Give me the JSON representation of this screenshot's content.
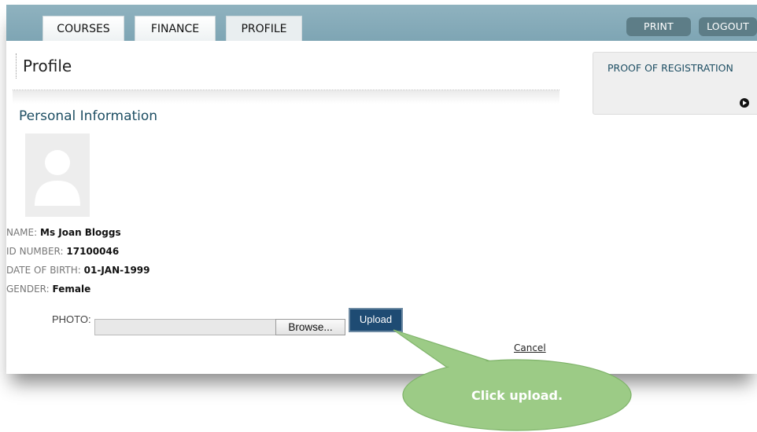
{
  "nav": {
    "tabs": [
      {
        "label": "COURSES"
      },
      {
        "label": "FINANCE"
      },
      {
        "label": "PROFILE"
      }
    ],
    "print_label": "PRINT",
    "logout_label": "LOGOUT"
  },
  "page": {
    "title": "Profile",
    "section_title": "Personal Information"
  },
  "profile": {
    "fields": [
      {
        "label": "NAME:",
        "value": "Ms Joan Bloggs"
      },
      {
        "label": "ID NUMBER:",
        "value": "17100046"
      },
      {
        "label": "DATE OF BIRTH:",
        "value": "01-JAN-1999"
      },
      {
        "label": "GENDER:",
        "value": "Female"
      }
    ]
  },
  "upload": {
    "photo_label": "PHOTO:",
    "file_value": "",
    "browse_label": "Browse...",
    "upload_label": "Upload",
    "cancel_label": "Cancel"
  },
  "sidebar": {
    "proof_label": "PROOF OF REGISTRATION"
  },
  "callout": {
    "text": "Click upload.",
    "fill": "#9ccb86",
    "stroke": "#7fb36a"
  },
  "colors": {
    "nav_bar": "#86abb9",
    "button_dark": "#5d7d87",
    "upload_button": "#1e4b73",
    "heading_blue": "#1d4e63"
  }
}
